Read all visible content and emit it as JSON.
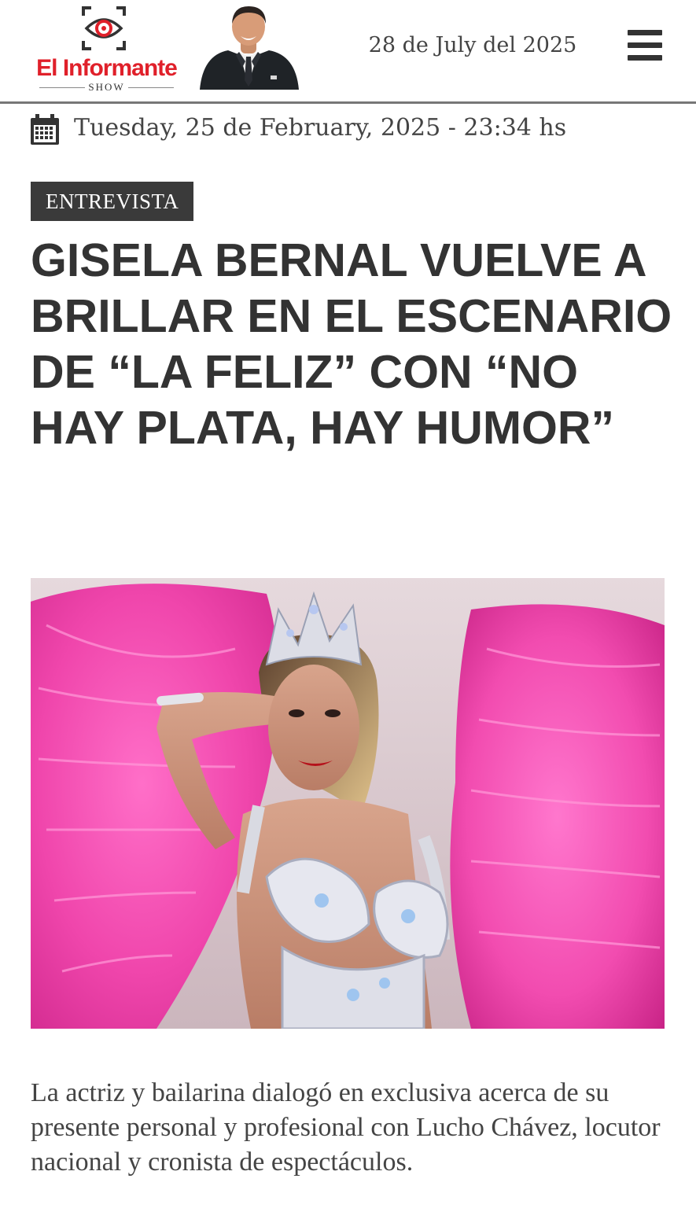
{
  "header": {
    "logo_title": "El Informante",
    "logo_subtitle": "SHOW",
    "date": "28 de July del 2025",
    "menu_icon": "hamburger-menu-icon",
    "brand_color": "#e0202a"
  },
  "article": {
    "published": "Tuesday, 25 de February, 2025 - 23:34 hs",
    "date_icon": "calendar-icon",
    "category": "ENTREVISTA",
    "headline": "GISELA BERNAL VUELVE A BRILLAR EN EL ESCENARIO DE “LA FELIZ” CON “NO HAY PLATA, HAY HUMOR”",
    "lead": "La actriz y bailarina dialogó en exclusiva acerca de su presente personal y profesional con Lucho Chávez, locutor nacional y cronista de espectáculos."
  }
}
